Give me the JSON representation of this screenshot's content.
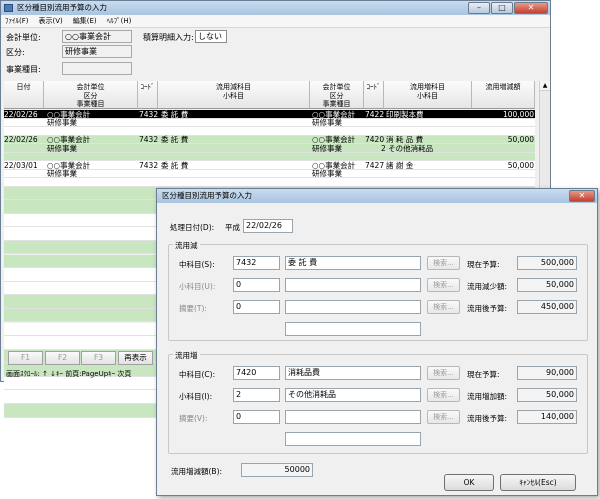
{
  "main": {
    "title": "区分種目別流用予算の入力",
    "menus": [
      "ﾌｧｲﾙ(F)",
      "表示(V)",
      "編集(E)",
      "ﾍﾙﾌﾟ(H)"
    ],
    "unit_label": "会計単位:",
    "unit_value": "○○事業会計",
    "summary_label": "積算明細入力:",
    "summary_value": "しない",
    "kubun_label": "区分:",
    "kubun_value": "研修事業",
    "shumoku_label": "事業種目:",
    "shumoku_value": "",
    "columns": [
      "日付",
      "会計単位\n区分\n事業種目",
      "ｺｰﾄﾞ",
      "流用減科目\n小科目",
      "会計単位\n区分\n事業種目",
      "ｺｰﾄﾞ",
      "流用増科目\n小科目",
      "流用増減額"
    ],
    "rows": [
      {
        "date": "22/02/26",
        "unit": "○○事業会計",
        "kubun": "研修事業",
        "code": "7432",
        "kamoku": "委 託 費",
        "sub": "",
        "unit2": "○○事業会計",
        "kubun2": "研修事業",
        "code2": "7422",
        "kamoku2": "印刷製本費",
        "sub2": "",
        "amount": "100,000",
        "state": "selected"
      },
      {
        "date": "22/02/26",
        "unit": "○○事業会計",
        "kubun": "研修事業",
        "code": "7432",
        "kamoku": "委 託 費",
        "sub": "",
        "unit2": "○○事業会計",
        "kubun2": "研修事業",
        "code2": "7420",
        "kamoku2": "消 耗 品 費",
        "sub2": "2 その他消耗品",
        "amount": "50,000",
        "state": "green"
      },
      {
        "date": "22/03/01",
        "unit": "○○事業会計",
        "kubun": "研修事業",
        "code": "7432",
        "kamoku": "委 託 費",
        "sub": "",
        "unit2": "○○事業会計",
        "kubun2": "研修事業",
        "code2": "7427",
        "kamoku2": "諸 謝 金",
        "sub2": "",
        "amount": "50,000",
        "state": "white"
      }
    ],
    "fkeys": [
      "F1",
      "F2",
      "F3",
      "再表示"
    ],
    "status": "画面ｽｸﾛｰﾙ: ↑ ↓ｷｰ 前頁:PageUpｷｰ 次頁"
  },
  "dialog": {
    "title": "区分種目別流用予算の入力",
    "date_label": "処理日付(D):",
    "era": "平成",
    "date_value": "22/02/26",
    "dec": {
      "group": "流用減",
      "chu_label": "中科目(S):",
      "chu_code": "7432",
      "chu_name": "委 託 費",
      "sho_label": "小科目(U):",
      "sho_code": "0",
      "sho_name": "",
      "teki_label": "摘要(T):",
      "teki_code": "0",
      "teki_name": "",
      "search": "検索...",
      "genzai_label": "現在予算:",
      "genzai_value": "500,000",
      "change_label": "流用減少額:",
      "change_value": "50,000",
      "after_label": "流用後予算:",
      "after_value": "450,000"
    },
    "inc": {
      "group": "流用増",
      "chu_label": "中科目(C):",
      "chu_code": "7420",
      "chu_name": "消耗品費",
      "sho_label": "小科目(I):",
      "sho_code": "2",
      "sho_name": "その他消耗品",
      "teki_label": "摘要(V):",
      "teki_code": "0",
      "teki_name": "",
      "search": "検索...",
      "genzai_label": "現在予算:",
      "genzai_value": "90,000",
      "change_label": "流用増加額:",
      "change_value": "50,000",
      "after_label": "流用後予算:",
      "after_value": "140,000"
    },
    "total_label": "流用増減額(B):",
    "total_value": "50000",
    "ok_label": "OK",
    "cancel_label": "ｷｬﾝｾﾙ(Esc)"
  },
  "colors": {
    "green_row": "#c8e6c0",
    "selected_row": "#000000",
    "titlebar": "#b8cfe8"
  }
}
